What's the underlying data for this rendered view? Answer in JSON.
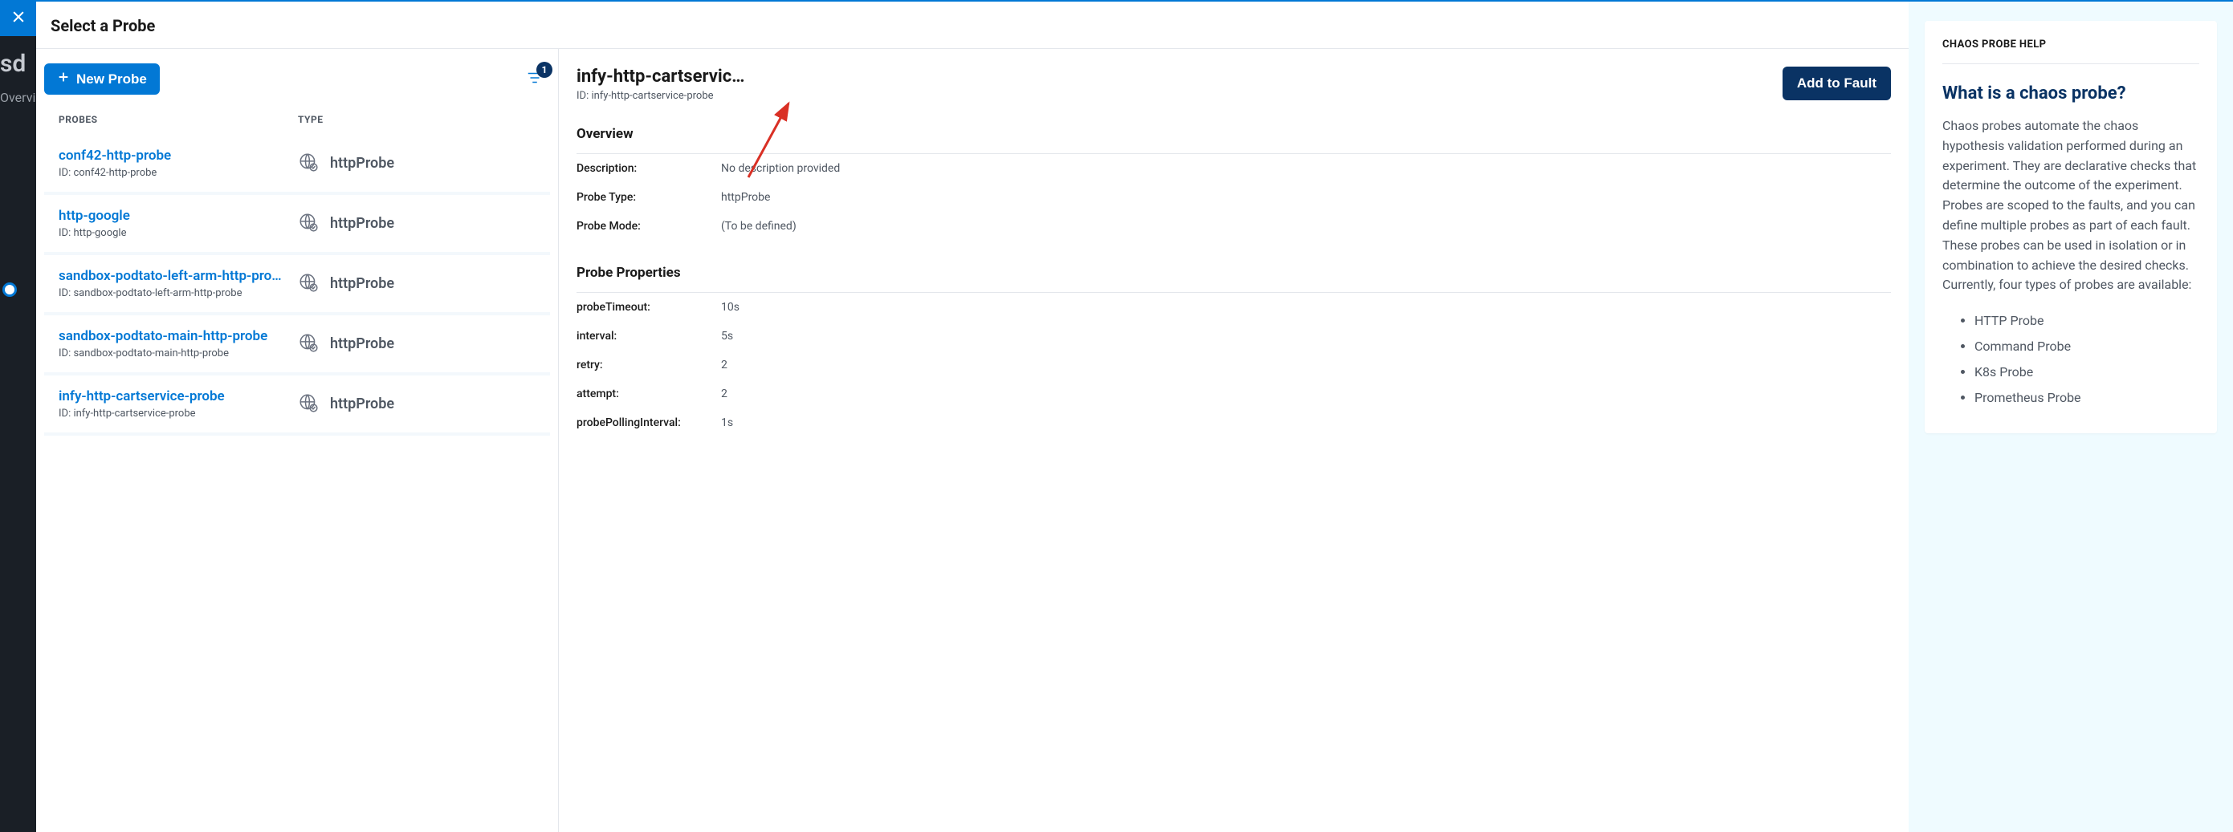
{
  "backdrop": {
    "line1": "sd",
    "line2": "Overvi"
  },
  "modal": {
    "title": "Select a Probe",
    "newProbeLabel": "New Probe",
    "filterCount": "1",
    "headers": {
      "probes": "PROBES",
      "type": "TYPE"
    },
    "rows": [
      {
        "name": "conf42-http-probe",
        "id": "ID: conf42-http-probe",
        "type": "httpProbe"
      },
      {
        "name": "http-google",
        "id": "ID: http-google",
        "type": "httpProbe"
      },
      {
        "name": "sandbox-podtato-left-arm-http-pro…",
        "id": "ID: sandbox-podtato-left-arm-http-probe",
        "type": "httpProbe"
      },
      {
        "name": "sandbox-podtato-main-http-probe",
        "id": "ID: sandbox-podtato-main-http-probe",
        "type": "httpProbe"
      },
      {
        "name": "infy-http-cartservice-probe",
        "id": "ID: infy-http-cartservice-probe",
        "type": "httpProbe"
      }
    ]
  },
  "details": {
    "title": "infy-http-cartservic…",
    "id": "ID: infy-http-cartservice-probe",
    "addToFault": "Add to Fault",
    "overviewTitle": "Overview",
    "overview": [
      {
        "k": "Description:",
        "v": "No description provided"
      },
      {
        "k": "Probe Type:",
        "v": "httpProbe"
      },
      {
        "k": "Probe Mode:",
        "v": "(To be defined)"
      }
    ],
    "propsTitle": "Probe Properties",
    "props": [
      {
        "k": "probeTimeout:",
        "v": "10s"
      },
      {
        "k": "interval:",
        "v": "5s"
      },
      {
        "k": "retry:",
        "v": "2"
      },
      {
        "k": "attempt:",
        "v": "2"
      },
      {
        "k": "probePollingInterval:",
        "v": "1s"
      }
    ]
  },
  "help": {
    "eyebrow": "CHAOS PROBE HELP",
    "title": "What is a chaos probe?",
    "body": "Chaos probes automate the chaos hypothesis validation performed during an experiment. They are declarative checks that determine the outcome of the experiment. Probes are scoped to the faults, and you can define multiple probes as part of each fault. These probes can be used in isolation or in combination to achieve the desired checks. Currently, four types of probes are available:",
    "items": [
      "HTTP Probe",
      "Command Probe",
      "K8s Probe",
      "Prometheus Probe"
    ]
  }
}
